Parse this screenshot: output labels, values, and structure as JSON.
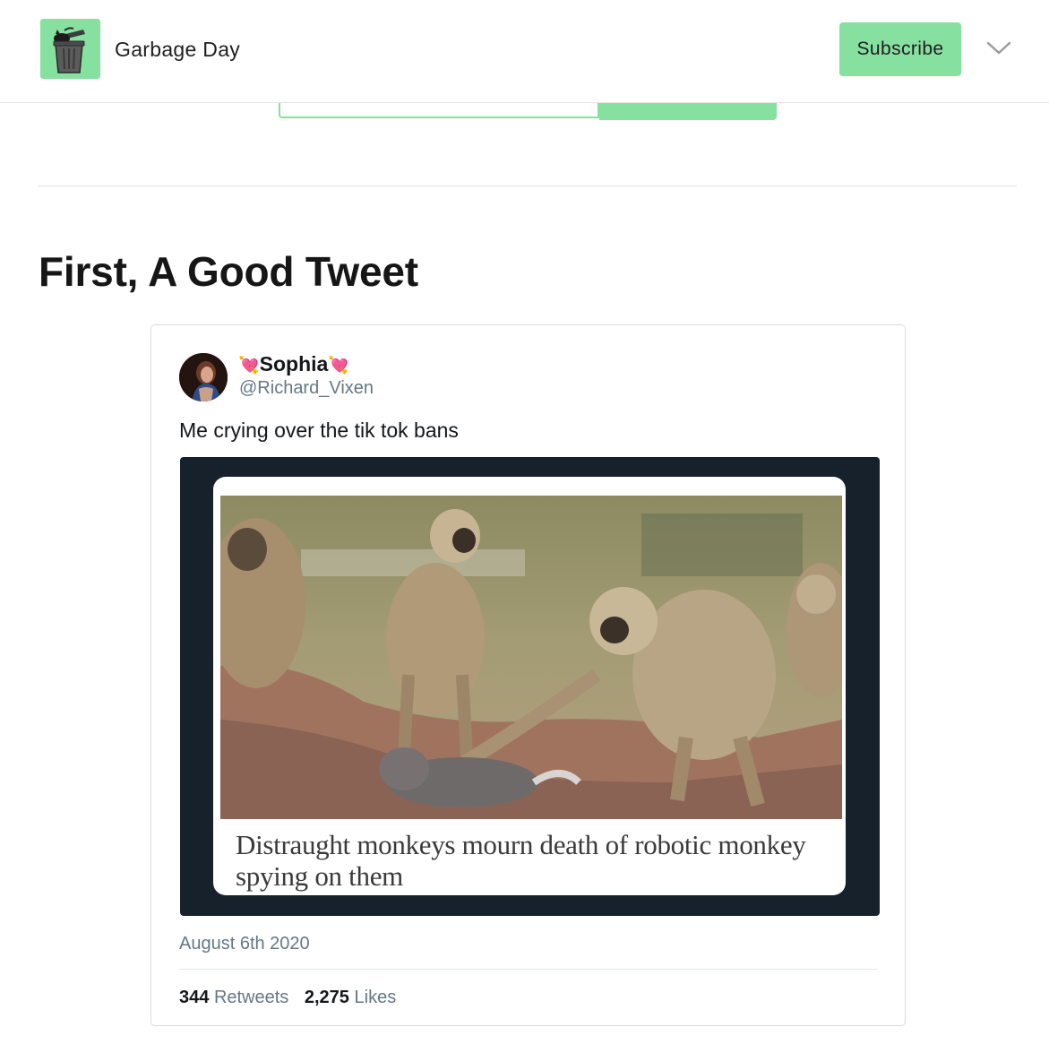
{
  "header": {
    "site_name": "Garbage Day",
    "subscribe_label": "Subscribe",
    "logo_icon": "trash-can-icon",
    "menu_icon": "chevron-down-icon",
    "accent_color": "#86e0a0"
  },
  "section": {
    "title": "First, A Good Tweet"
  },
  "tweet": {
    "display_name": "Sophia",
    "name_emoji": "💘",
    "handle": "@Richard_Vixen",
    "text": "Me crying over the tik tok bans",
    "media_headline": "Distraught monkeys mourn death of robotic monkey spying on them",
    "date": "August 6th 2020",
    "retweets_count": "344",
    "retweets_label": "Retweets",
    "likes_count": "2,275",
    "likes_label": "Likes"
  }
}
